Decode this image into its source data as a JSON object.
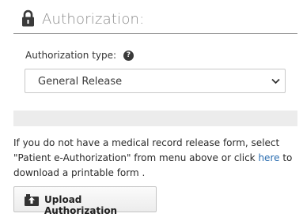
{
  "header": {
    "title": "Authorization:",
    "icon": "lock-icon"
  },
  "form": {
    "type_label": "Authorization type:",
    "help_icon_glyph": "?",
    "selected_type": "General Release"
  },
  "info": {
    "text_before_link": "If you do not have a medical record release form, select \"Patient e-Authorization\" from menu above or click ",
    "link_text": "here",
    "text_after_link": " to download a printable form ."
  },
  "upload_button": {
    "label": "Upload Authorization",
    "icon": "upload-icon"
  },
  "colors": {
    "link": "#2a6db0",
    "band": "#ececec",
    "title": "#8a8a8a"
  }
}
